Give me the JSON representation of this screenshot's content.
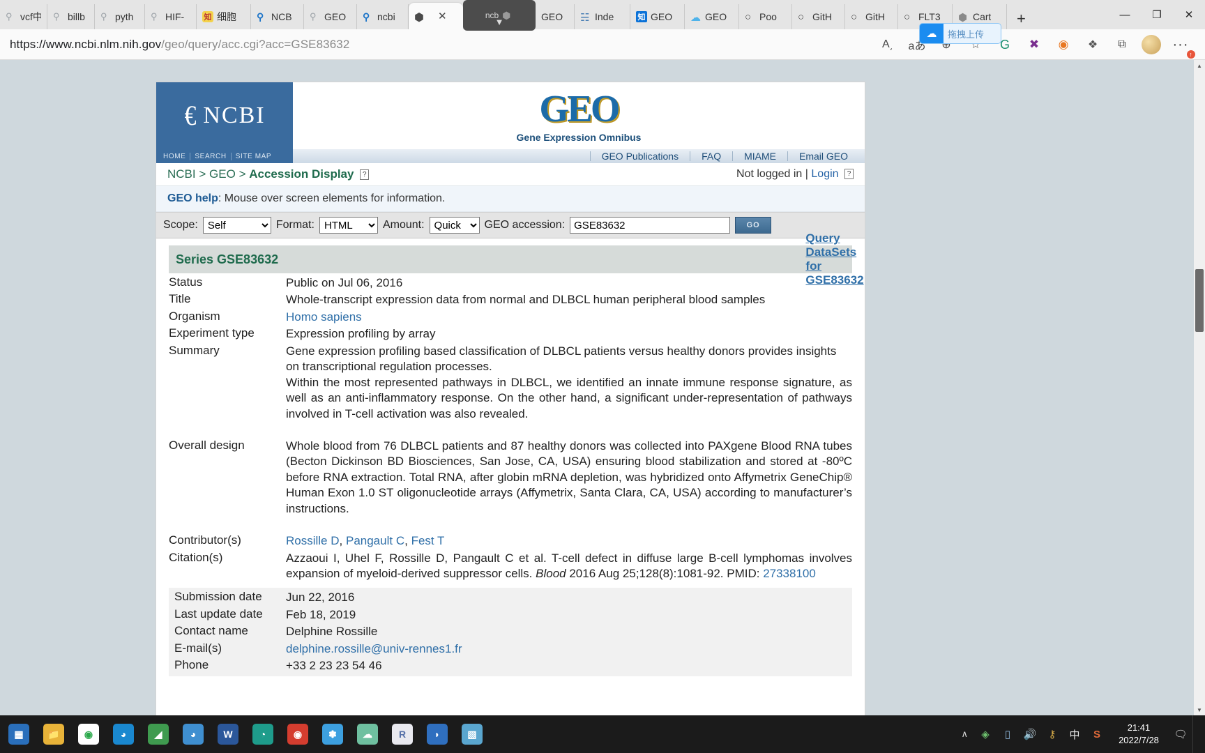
{
  "browser": {
    "tabs": [
      {
        "label": "vcf中",
        "icon": "search-icon"
      },
      {
        "label": "billb",
        "icon": "search-icon"
      },
      {
        "label": "pyth",
        "icon": "search-icon"
      },
      {
        "label": "HIF-",
        "icon": "search-icon"
      },
      {
        "label": "细胞",
        "icon": "zhihu-icon"
      },
      {
        "label": "NCB",
        "icon": "search-icon"
      },
      {
        "label": "GEO",
        "icon": "search-icon"
      },
      {
        "label": "ncbi",
        "icon": "search-icon"
      },
      {
        "label": "",
        "icon": "edge-icon",
        "active": true
      },
      {
        "label": "ncb",
        "icon": "edge-icon",
        "dragging": true
      },
      {
        "label": "GEO",
        "icon": "edge-icon"
      },
      {
        "label": "Inde",
        "icon": "ncbi-icon"
      },
      {
        "label": "GEO",
        "icon": "zhihu-icon"
      },
      {
        "label": "GEO",
        "icon": "cloud-icon"
      },
      {
        "label": "Poo",
        "icon": "github-icon"
      },
      {
        "label": "GitH",
        "icon": "github-icon"
      },
      {
        "label": "GitH",
        "icon": "github-icon"
      },
      {
        "label": "FLT3",
        "icon": "github-icon"
      },
      {
        "label": "Cart",
        "icon": "edge-icon"
      }
    ],
    "new_tab_label": "+",
    "window_controls": {
      "minimize": "—",
      "maximize": "❐",
      "close": "✕"
    },
    "url_prefix": "https://www.ncbi.nlm.nih.gov",
    "url_suffix": "/geo/query/acc.cgi?acc=GSE83632",
    "toolbar_icons": [
      {
        "name": "read-aloud-icon",
        "glyph": "A͵"
      },
      {
        "name": "translate-icon",
        "glyph": "aあ"
      },
      {
        "name": "zoom-icon",
        "glyph": "⊕"
      },
      {
        "name": "add-favorite-icon",
        "glyph": "☆"
      },
      {
        "name": "grammarly-extension-icon",
        "glyph": "G"
      },
      {
        "name": "x-extension-icon",
        "glyph": "✖"
      },
      {
        "name": "orange-extension-icon",
        "glyph": "◉"
      },
      {
        "name": "puzzle-extension-icon",
        "glyph": "❖"
      },
      {
        "name": "collections-icon",
        "glyph": "⧉"
      }
    ],
    "extension_tooltip": "拖拽上传",
    "more_label": "···"
  },
  "site": {
    "logo_text": "NCBI",
    "geo_word": "GEO",
    "geo_subtitle": "Gene Expression Omnibus",
    "left_nav": [
      "HOME",
      "SEARCH",
      "SITE MAP"
    ],
    "right_nav": [
      "GEO Publications",
      "FAQ",
      "MIAME",
      "Email GEO"
    ],
    "breadcrumb": {
      "root": "NCBI",
      "sep": ">",
      "second": "GEO",
      "current": "Accession Display"
    },
    "login": {
      "status": "Not logged in",
      "divider": "|",
      "link": "Login"
    },
    "help_label": "GEO help",
    "help_text": ": Mouse over screen elements for information."
  },
  "form": {
    "scope_label": "Scope:",
    "scope_value": "Self",
    "format_label": "Format:",
    "format_value": "HTML",
    "amount_label": "Amount:",
    "amount_value": "Quick",
    "accession_label": "GEO accession:",
    "accession_value": "GSE83632",
    "go_label": "GO"
  },
  "series": {
    "header_title": "Series GSE83632",
    "header_query": "Query DataSets for GSE83632",
    "fields": {
      "status_label": "Status",
      "status_value": "Public on Jul 06, 2016",
      "title_label": "Title",
      "title_value": "Whole-transcript expression data from normal and DLBCL human peripheral blood samples",
      "organism_label": "Organism",
      "organism_value": "Homo sapiens",
      "exptype_label": "Experiment type",
      "exptype_value": "Expression profiling by array",
      "summary_label": "Summary",
      "summary_p1": "Gene expression profiling based classification of DLBCL patients versus healthy donors provides insights on transcriptional regulation processes.",
      "summary_p2": "Within the most represented pathways in DLBCL, we identified an innate immune response signature, as well as an anti-inflammatory response. On the other hand, a significant under-representation of pathways involved in T-cell activation was also revealed.",
      "design_label": "Overall design",
      "design_value": "Whole blood from 76 DLBCL patients and 87 healthy donors was collected into PAXgene Blood RNA tubes (Becton Dickinson BD Biosciences, San Jose, CA, USA) ensuring blood stabilization and stored at -80ºC before RNA extraction. Total RNA, after globin mRNA depletion, was hybridized onto Affymetrix GeneChip® Human Exon 1.0 ST oligonucleotide arrays (Affymetrix, Santa Clara, CA, USA) according to manufacturer’s instructions.",
      "contributors_label": "Contributor(s)",
      "contributors": [
        "Rossille D",
        "Pangault C",
        "Fest T"
      ],
      "citation_label": "Citation(s)",
      "citation_text_1": "Azzaoui I, Uhel F, Rossille D, Pangault C et al. T-cell defect in diffuse large B-cell lymphomas involves expansion of myeloid-derived suppressor cells. ",
      "citation_journal": "Blood",
      "citation_text_2": " 2016 Aug 25;128(8):1081-92. PMID: ",
      "citation_pmid": "27338100",
      "submission_label": "Submission date",
      "submission_value": "Jun 22, 2016",
      "lastupdate_label": "Last update date",
      "lastupdate_value": "Feb 18, 2019",
      "contact_label": "Contact name",
      "contact_value": "Delphine Rossille",
      "email_label": "E-mail(s)",
      "email_value": "delphine.rossille@univ-rennes1.fr",
      "phone_label": "Phone",
      "phone_value": "+33 2 23 23 54 46"
    }
  },
  "taskbar": {
    "apps": [
      {
        "name": "start-icon",
        "glyph": "⊞",
        "color": "#2a6fbb"
      },
      {
        "name": "file-explorer-icon",
        "glyph": "🗎",
        "color": "#e8b339"
      },
      {
        "name": "chrome-icon",
        "glyph": "◉",
        "color": "#2aa84a"
      },
      {
        "name": "edge-icon",
        "glyph": "◑",
        "color": "#1a88cf"
      },
      {
        "name": "green-app-icon",
        "glyph": "◢",
        "color": "#3f9b4f"
      },
      {
        "name": "edge-dev-icon",
        "glyph": "◑",
        "color": "#3f8fd0"
      },
      {
        "name": "word-icon",
        "glyph": "W",
        "color": "#2b579a"
      },
      {
        "name": "teal-app-icon",
        "glyph": "◔",
        "color": "#1e9c8b"
      },
      {
        "name": "red-app-icon",
        "glyph": "◉",
        "color": "#d43d2f"
      },
      {
        "name": "blue-app-icon",
        "glyph": "✽",
        "color": "#3da0e0"
      },
      {
        "name": "cloud-app-icon",
        "glyph": "☁",
        "color": "#6fc0a0"
      },
      {
        "name": "rstudio-icon",
        "glyph": "R",
        "color": "#7a8ab5"
      },
      {
        "name": "firefox-dev-icon",
        "glyph": "◗",
        "color": "#2f6fbf"
      },
      {
        "name": "blue-doc-icon",
        "glyph": "▧",
        "color": "#5aa6cf"
      }
    ],
    "tray": [
      {
        "name": "tray-chevron-icon",
        "glyph": "∧"
      },
      {
        "name": "tray-green-icon",
        "glyph": "◈"
      },
      {
        "name": "tray-monitor-icon",
        "glyph": "⬛"
      },
      {
        "name": "volume-icon",
        "glyph": "🔊"
      },
      {
        "name": "tray-key-icon",
        "glyph": "⚿"
      },
      {
        "name": "ime-icon",
        "glyph": "中"
      },
      {
        "name": "sogou-icon",
        "glyph": "S"
      }
    ],
    "clock_time": "21:41",
    "clock_date": "2022/7/28",
    "notification_glyph": "💭"
  }
}
